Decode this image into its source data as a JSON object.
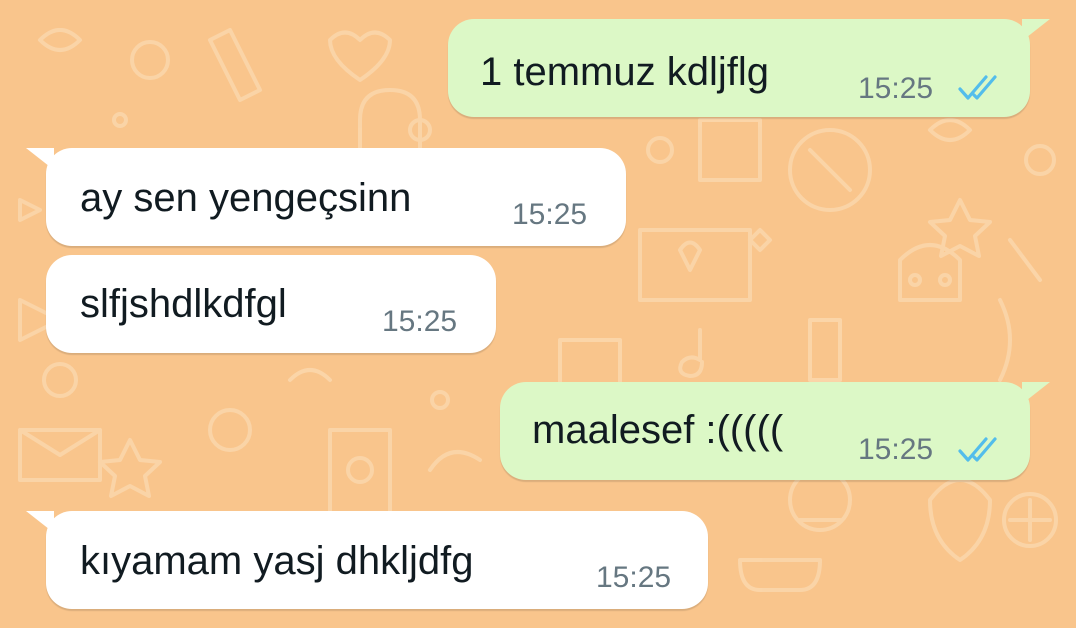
{
  "colors": {
    "wallpaper": "#f9c58c",
    "incoming_bubble": "#ffffff",
    "outgoing_bubble": "#dcf8c6",
    "text": "#111b21",
    "timestamp": "#667781",
    "read_ticks": "#53bdeb"
  },
  "messages": [
    {
      "direction": "outgoing",
      "text": "1 temmuz kdljflg",
      "time": "15:25",
      "status": "read",
      "status_icon": "double-check-icon"
    },
    {
      "direction": "incoming",
      "text": "ay sen yengeçsinn",
      "time": "15:25"
    },
    {
      "direction": "incoming",
      "text": "slfjshdlkdfgl",
      "time": "15:25"
    },
    {
      "direction": "outgoing",
      "text": "maalesef :(((((",
      "time": "15:25",
      "status": "read",
      "status_icon": "double-check-icon"
    },
    {
      "direction": "incoming",
      "text": "kıyamam yasj dhkljdfg",
      "time": "15:25"
    }
  ]
}
